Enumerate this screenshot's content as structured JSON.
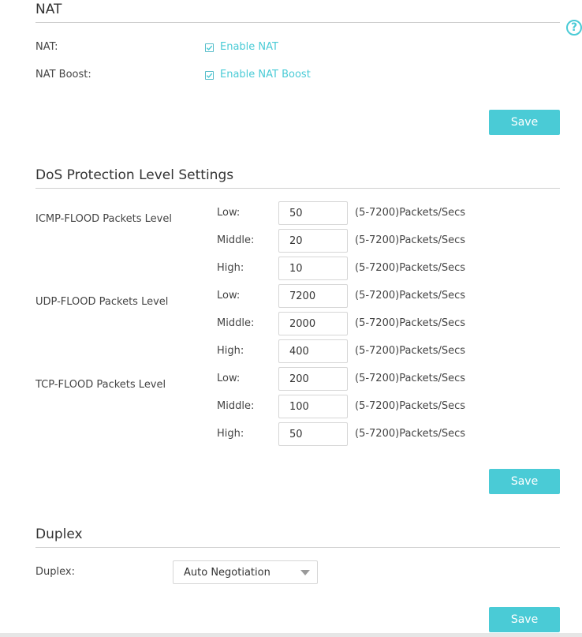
{
  "nat": {
    "title": "NAT",
    "nat_label": "NAT:",
    "nat_checkbox_label": "Enable NAT",
    "nat_checked": true,
    "boost_label": "NAT Boost:",
    "boost_checkbox_label": "Enable NAT Boost",
    "boost_checked": true,
    "save_label": "Save"
  },
  "dos": {
    "title": "DoS Protection Level Settings",
    "groups": [
      {
        "name": "ICMP-FLOOD Packets Level",
        "levels": [
          {
            "label": "Low:",
            "value": "50"
          },
          {
            "label": "Middle:",
            "value": "20"
          },
          {
            "label": "High:",
            "value": "10"
          }
        ]
      },
      {
        "name": "UDP-FLOOD Packets Level",
        "levels": [
          {
            "label": "Low:",
            "value": "7200"
          },
          {
            "label": "Middle:",
            "value": "2000"
          },
          {
            "label": "High:",
            "value": "400"
          }
        ]
      },
      {
        "name": "TCP-FLOOD Packets Level",
        "levels": [
          {
            "label": "Low:",
            "value": "200"
          },
          {
            "label": "Middle:",
            "value": "100"
          },
          {
            "label": "High:",
            "value": "50"
          }
        ]
      }
    ],
    "range_note": "(5-7200)Packets/Secs",
    "save_label": "Save"
  },
  "duplex": {
    "title": "Duplex",
    "label": "Duplex:",
    "selected": "Auto Negotiation",
    "save_label": "Save"
  },
  "help": {
    "icon": "help-icon",
    "glyph": "?"
  },
  "colors": {
    "accent": "#4acbd6",
    "rule": "#cfcfcf",
    "text": "#333333"
  }
}
